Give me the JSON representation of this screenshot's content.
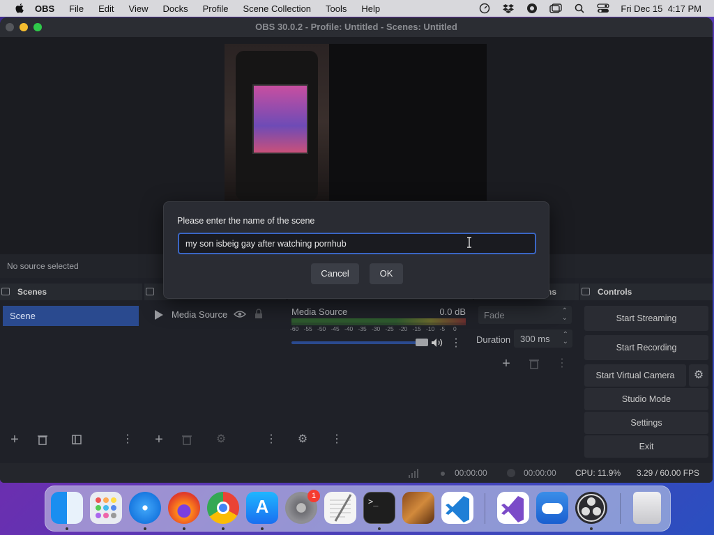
{
  "menubar": {
    "items": [
      "OBS",
      "File",
      "Edit",
      "View",
      "Docks",
      "Profile",
      "Scene Collection",
      "Tools",
      "Help"
    ],
    "clock": "Fri Dec 15  4:17 PM"
  },
  "window": {
    "title": "OBS 30.0.2 - Profile: Untitled - Scenes: Untitled"
  },
  "source_bar": {
    "status": "No source selected"
  },
  "scenes": {
    "header": "Scenes",
    "items": [
      "Scene"
    ]
  },
  "sources": {
    "items": [
      {
        "name": "Media Source"
      }
    ]
  },
  "mixer": {
    "source": "Media Source",
    "level": "0.0 dB",
    "ticks": [
      "-60",
      "-55",
      "-50",
      "-45",
      "-40",
      "-35",
      "-30",
      "-25",
      "-20",
      "-15",
      "-10",
      "-5",
      "0"
    ]
  },
  "transitions": {
    "header_fragment": "ns",
    "type": "Fade",
    "duration_label": "Duration",
    "duration_value": "300 ms"
  },
  "controls": {
    "header": "Controls",
    "start_streaming": "Start Streaming",
    "start_recording": "Start Recording",
    "start_virtual_camera": "Start Virtual Camera",
    "studio_mode": "Studio Mode",
    "settings": "Settings",
    "exit": "Exit"
  },
  "status": {
    "stream_time": "00:00:00",
    "rec_time": "00:00:00",
    "cpu": "CPU: 11.9%",
    "fps": "3.29 / 60.00 FPS"
  },
  "dialog": {
    "label": "Please enter the name of the scene",
    "input_value": "my son isbeig gay after watching pornhub",
    "cancel": "Cancel",
    "ok": "OK"
  },
  "dock": {
    "badge": "1"
  },
  "colors": {
    "accent": "#3a66c4",
    "scene_selected": "#2a4a8f",
    "window_bg": "#1f2128"
  }
}
